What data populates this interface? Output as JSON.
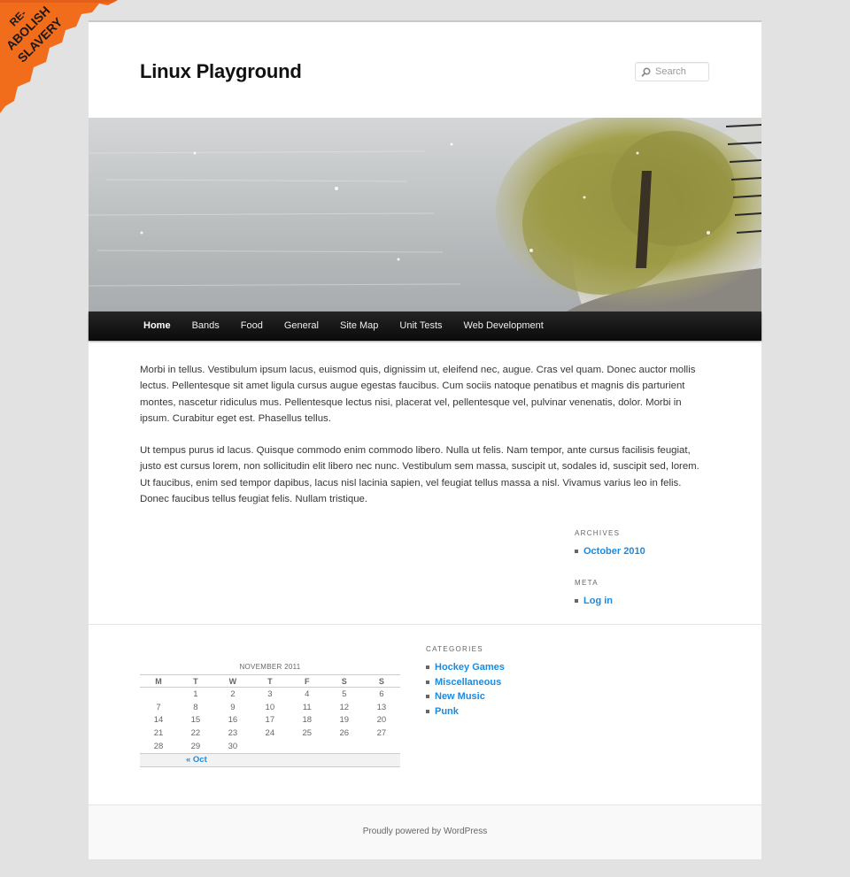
{
  "ribbon": {
    "line1": "RE-",
    "line2": "ABOLISH",
    "line3": "SLAVERY",
    "color": "#f26d1b"
  },
  "header": {
    "site_title": "Linux Playground",
    "search_placeholder": "Search",
    "search_icon": "search-icon",
    "header_image": "snowy-lake-willow-tree"
  },
  "nav": {
    "items": [
      {
        "label": "Home"
      },
      {
        "label": "Bands"
      },
      {
        "label": "Food"
      },
      {
        "label": "General"
      },
      {
        "label": "Site Map"
      },
      {
        "label": "Unit Tests"
      },
      {
        "label": "Web Development"
      }
    ]
  },
  "content": {
    "paragraphs": [
      "Morbi in tellus. Vestibulum ipsum lacus, euismod quis, dignissim ut, eleifend nec, augue. Cras vel quam. Donec auctor mollis lectus. Pellentesque sit amet ligula cursus augue egestas faucibus. Cum sociis natoque penatibus et magnis dis parturient montes, nascetur ridiculus mus. Pellentesque lectus nisi, placerat vel, pellentesque vel, pulvinar venenatis, dolor. Morbi in ipsum. Curabitur eget est. Phasellus tellus.",
      "Ut tempus purus id lacus. Quisque commodo enim commodo libero. Nulla ut felis. Nam tempor, ante cursus facilisis feugiat, justo est cursus lorem, non sollicitudin elit libero nec nunc. Vestibulum sem massa, suscipit ut, sodales id, suscipit sed, lorem. Ut faucibus, enim sed tempor dapibus, lacus nisl lacinia sapien, vel feugiat tellus massa a nisl. Vivamus varius leo in felis. Donec faucibus tellus feugiat felis. Nullam tristique."
    ]
  },
  "sidebar": {
    "archives": {
      "title": "ARCHIVES",
      "items": [
        "October 2010"
      ]
    },
    "meta": {
      "title": "META",
      "items": [
        "Log in"
      ]
    }
  },
  "calendar": {
    "caption": "NOVEMBER 2011",
    "days": [
      "M",
      "T",
      "W",
      "T",
      "F",
      "S",
      "S"
    ],
    "weeks": [
      [
        "",
        "1",
        "2",
        "3",
        "4",
        "5",
        "6"
      ],
      [
        "7",
        "8",
        "9",
        "10",
        "11",
        "12",
        "13"
      ],
      [
        "14",
        "15",
        "16",
        "17",
        "18",
        "19",
        "20"
      ],
      [
        "21",
        "22",
        "23",
        "24",
        "25",
        "26",
        "27"
      ],
      [
        "28",
        "29",
        "30",
        "",
        "",
        "",
        ""
      ]
    ],
    "prev_link": "« Oct"
  },
  "categories": {
    "title": "CATEGORIES",
    "items": [
      "Hockey Games",
      "Miscellaneous",
      "New Music",
      "Punk"
    ]
  },
  "footer": {
    "text": "Proudly powered by WordPress"
  },
  "colors": {
    "link": "#1b8be0",
    "nav_bg": "#1a1a1a",
    "page_bg": "#e2e2e2"
  }
}
